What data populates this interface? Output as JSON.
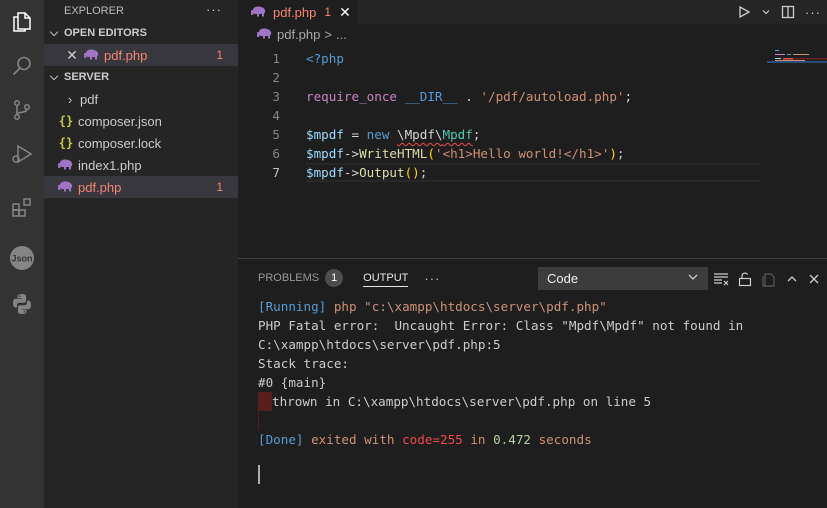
{
  "activity_bar": {
    "items": [
      {
        "name": "explorer",
        "icon": "files-icon",
        "active": true
      },
      {
        "name": "search",
        "icon": "search-icon"
      },
      {
        "name": "source-control",
        "icon": "source-control-icon"
      },
      {
        "name": "run-debug",
        "icon": "run-debug-icon"
      },
      {
        "name": "extensions",
        "icon": "extensions-icon"
      },
      {
        "name": "json",
        "icon": "json-icon",
        "label": "Json"
      },
      {
        "name": "python",
        "icon": "python-icon"
      }
    ]
  },
  "sidebar": {
    "title": "EXPLORER",
    "more": "···",
    "open_editors": {
      "label": "OPEN EDITORS",
      "items": [
        {
          "name": "pdf.php",
          "problems": "1"
        }
      ]
    },
    "server": {
      "label": "SERVER",
      "items": [
        {
          "name": "pdf",
          "type": "folder"
        },
        {
          "name": "composer.json",
          "type": "json"
        },
        {
          "name": "composer.lock",
          "type": "json"
        },
        {
          "name": "index1.php",
          "type": "php"
        },
        {
          "name": "pdf.php",
          "type": "php",
          "problems": "1",
          "selected": true
        }
      ]
    }
  },
  "editor": {
    "tab": {
      "name": "pdf.php",
      "problems": "1",
      "close": "✕"
    },
    "breadcrumb": {
      "file": "pdf.php",
      "sep": ">",
      "more": "..."
    },
    "lines": [
      {
        "n": "1",
        "tokens": [
          {
            "t": "<?php",
            "c": "kw-blue"
          }
        ]
      },
      {
        "n": "2",
        "tokens": []
      },
      {
        "n": "3",
        "tokens": [
          {
            "t": "require_once",
            "c": "kw-pink"
          },
          {
            "t": " ",
            "c": "plain"
          },
          {
            "t": "__DIR__",
            "c": "kw-blue"
          },
          {
            "t": " . ",
            "c": "plain"
          },
          {
            "t": "'/pdf/autoload.php'",
            "c": "str"
          },
          {
            "t": ";",
            "c": "plain"
          }
        ]
      },
      {
        "n": "4",
        "tokens": []
      },
      {
        "n": "5",
        "tokens": [
          {
            "t": "$mpdf",
            "c": "var"
          },
          {
            "t": " = ",
            "c": "plain"
          },
          {
            "t": "new",
            "c": "kw-blue"
          },
          {
            "t": " ",
            "c": "plain"
          },
          {
            "t": "\\Mpdf\\",
            "c": "plain squiggle"
          },
          {
            "t": "Mpdf",
            "c": "cls squiggle"
          },
          {
            "t": ";",
            "c": "plain"
          }
        ]
      },
      {
        "n": "6",
        "tokens": [
          {
            "t": "$mpdf",
            "c": "var"
          },
          {
            "t": "->",
            "c": "plain"
          },
          {
            "t": "WriteHTML",
            "c": "fn"
          },
          {
            "t": "(",
            "c": "paren"
          },
          {
            "t": "'<h1>Hello world!</h1>'",
            "c": "str"
          },
          {
            "t": ")",
            "c": "paren"
          },
          {
            "t": ";",
            "c": "plain"
          }
        ]
      },
      {
        "n": "7",
        "current": true,
        "tokens": [
          {
            "t": "$mpdf",
            "c": "var"
          },
          {
            "t": "->",
            "c": "plain"
          },
          {
            "t": "Output",
            "c": "fn"
          },
          {
            "t": "()",
            "c": "paren"
          },
          {
            "t": ";",
            "c": "plain"
          }
        ]
      }
    ]
  },
  "panel": {
    "tabs": [
      {
        "label": "PROBLEMS",
        "badge": "1"
      },
      {
        "label": "OUTPUT",
        "active": true
      }
    ],
    "more": "···",
    "channel": "Code",
    "output_lines": [
      {
        "segs": [
          {
            "t": "[Running]",
            "c": "o-blue"
          },
          {
            "t": " php \"c:\\xampp\\htdocs\\server\\pdf.php\"",
            "c": "o-orange"
          }
        ]
      },
      {
        "segs": [
          {
            "t": "PHP Fatal error:  Uncaught Error: Class \"Mpdf\\Mpdf\" not found in",
            "c": ""
          }
        ]
      },
      {
        "segs": [
          {
            "t": "C:\\xampp\\htdocs\\server\\pdf.php:5",
            "c": ""
          }
        ]
      },
      {
        "segs": [
          {
            "t": "Stack trace:",
            "c": ""
          }
        ]
      },
      {
        "segs": [
          {
            "t": "#0 {main}",
            "c": ""
          }
        ]
      },
      {
        "mark": true,
        "segs": [
          {
            "t": "thrown in C:\\xampp\\htdocs\\server\\pdf.php on line 5",
            "c": ""
          }
        ]
      },
      {
        "bar": true,
        "segs": []
      },
      {
        "segs": [
          {
            "t": "[Done]",
            "c": "o-blue"
          },
          {
            "t": " exited with ",
            "c": "o-orange"
          },
          {
            "t": "code=255",
            "c": "o-red"
          },
          {
            "t": " in ",
            "c": "o-orange"
          },
          {
            "t": "0.472",
            "c": "o-green"
          },
          {
            "t": " seconds",
            "c": "o-orange"
          }
        ]
      }
    ]
  }
}
